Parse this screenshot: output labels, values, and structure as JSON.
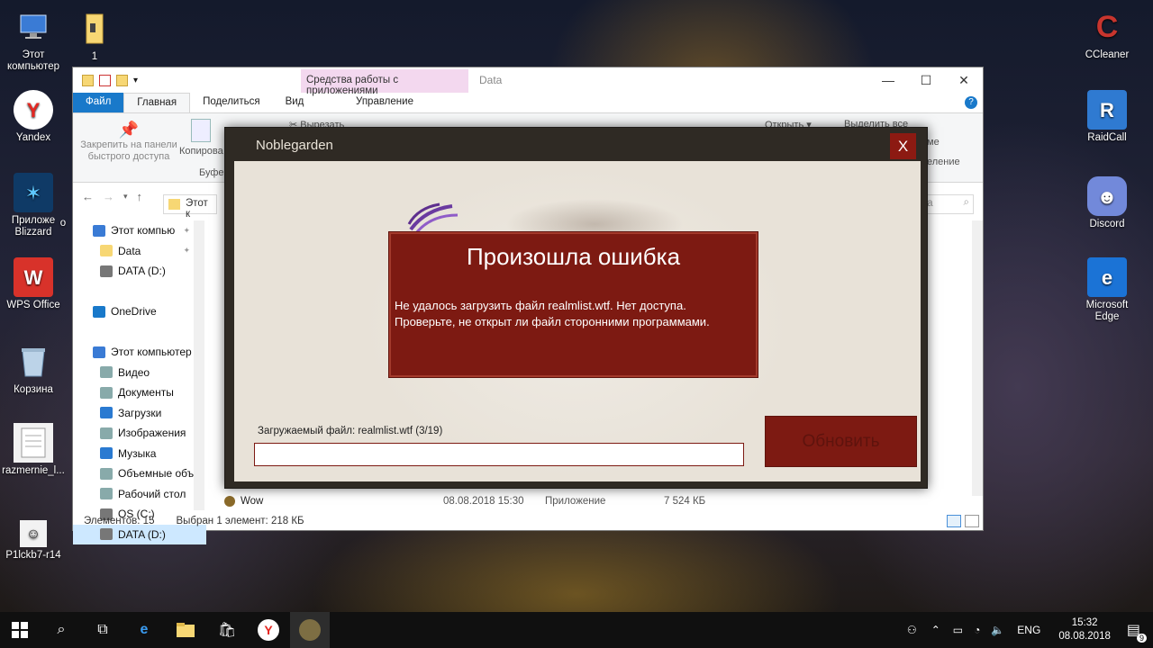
{
  "desktop": {
    "icons_left": [
      {
        "label": "Этот компьютер",
        "icon": "computer-icon",
        "color": "#3a7bd5"
      },
      {
        "label": "Yandex",
        "icon": "yandex-icon",
        "color": "#e52620"
      },
      {
        "label": "Приложе Blizzard",
        "icon": "blizzard-icon",
        "color": "#0f3a66"
      },
      {
        "label": "WPS Office",
        "icon": "wps-icon",
        "color": "#d8322a"
      },
      {
        "label": "Корзина",
        "icon": "recycle-bin-icon",
        "color": "#6b8fb0"
      },
      {
        "label": "razmernie_l...",
        "icon": "document-icon",
        "color": "#e8e8e8"
      },
      {
        "label": "P1lckb7-r14",
        "icon": "image-file-icon",
        "color": "#e8e8e8"
      }
    ],
    "folder_1": {
      "label": "1"
    },
    "partial_label": "о",
    "icons_right": [
      {
        "label": "CCleaner",
        "icon": "ccleaner-icon",
        "color": "#c8352e"
      },
      {
        "label": "RaidCall",
        "icon": "raidcall-icon",
        "color": "#2f7ad1"
      },
      {
        "label": "Discord",
        "icon": "discord-icon",
        "color": "#7289da"
      },
      {
        "label": "Microsoft Edge",
        "icon": "edge-icon",
        "color": "#1b73d6"
      }
    ]
  },
  "explorer": {
    "context_tab": "Средства работы с приложениями",
    "path_title": "Data",
    "tabs": {
      "file": "Файл",
      "home": "Главная",
      "share": "Поделиться",
      "view": "Вид",
      "manage": "Управление"
    },
    "ribbon": {
      "pin": "Закрепить на панели быстрого доступа",
      "copy": "Копирова",
      "clipboard": "Буфер",
      "cut": "Вырезать",
      "open": "Открыть ▾",
      "select_all": "Выделить все",
      "partial1": "ме",
      "partial2": "еление"
    },
    "address": "Этот к",
    "search_partial": "ta",
    "nav_items": [
      {
        "label": "Этот компью",
        "icon": "computer-icon",
        "pin": true,
        "indent": 1
      },
      {
        "label": "Data",
        "icon": "folder-icon",
        "pin": true,
        "indent": 2
      },
      {
        "label": "DATA (D:)",
        "icon": "drive-icon",
        "pin": false,
        "indent": 2
      },
      {
        "label": "",
        "icon": "",
        "pin": false,
        "indent": 0
      },
      {
        "label": "OneDrive",
        "icon": "onedrive-icon",
        "pin": false,
        "indent": 1
      },
      {
        "label": "",
        "icon": "",
        "pin": false,
        "indent": 0
      },
      {
        "label": "Этот компьютер",
        "icon": "computer-icon",
        "pin": false,
        "indent": 1
      },
      {
        "label": "Видео",
        "icon": "video-icon",
        "pin": false,
        "indent": 2
      },
      {
        "label": "Документы",
        "icon": "documents-icon",
        "pin": false,
        "indent": 2
      },
      {
        "label": "Загрузки",
        "icon": "downloads-icon",
        "pin": false,
        "indent": 2
      },
      {
        "label": "Изображения",
        "icon": "pictures-icon",
        "pin": false,
        "indent": 2
      },
      {
        "label": "Музыка",
        "icon": "music-icon",
        "pin": false,
        "indent": 2
      },
      {
        "label": "Объемные объ",
        "icon": "3d-objects-icon",
        "pin": false,
        "indent": 2
      },
      {
        "label": "Рабочий стол",
        "icon": "desktop-icon",
        "pin": false,
        "indent": 2
      },
      {
        "label": "OS (C:)",
        "icon": "drive-icon",
        "pin": false,
        "indent": 2
      },
      {
        "label": "DATA (D:)",
        "icon": "drive-icon",
        "pin": false,
        "indent": 2,
        "selected": true
      }
    ],
    "file_row": {
      "name": "Wow",
      "date": "08.08.2018 15:30",
      "type": "Приложение",
      "size": "7 524 КБ"
    },
    "status": {
      "count": "Элементов: 15",
      "selected": "Выбран 1 элемент: 218 КБ"
    }
  },
  "launcher": {
    "title": "Noblegarden",
    "close": "X",
    "error_title": "Произошла ошибка",
    "error_message": "Не удалось загрузить файл realmlist.wtf. Нет доступа. Проверьте, не открыт ли файл сторонними программами.",
    "download_label": "Загружаемый файл: realmlist.wtf (3/19)",
    "update_button": "Обновить",
    "accent_color": "#7d1a12"
  },
  "taskbar": {
    "lang": "ENG",
    "time": "15:32",
    "date": "08.08.2018",
    "notifications": "9"
  }
}
